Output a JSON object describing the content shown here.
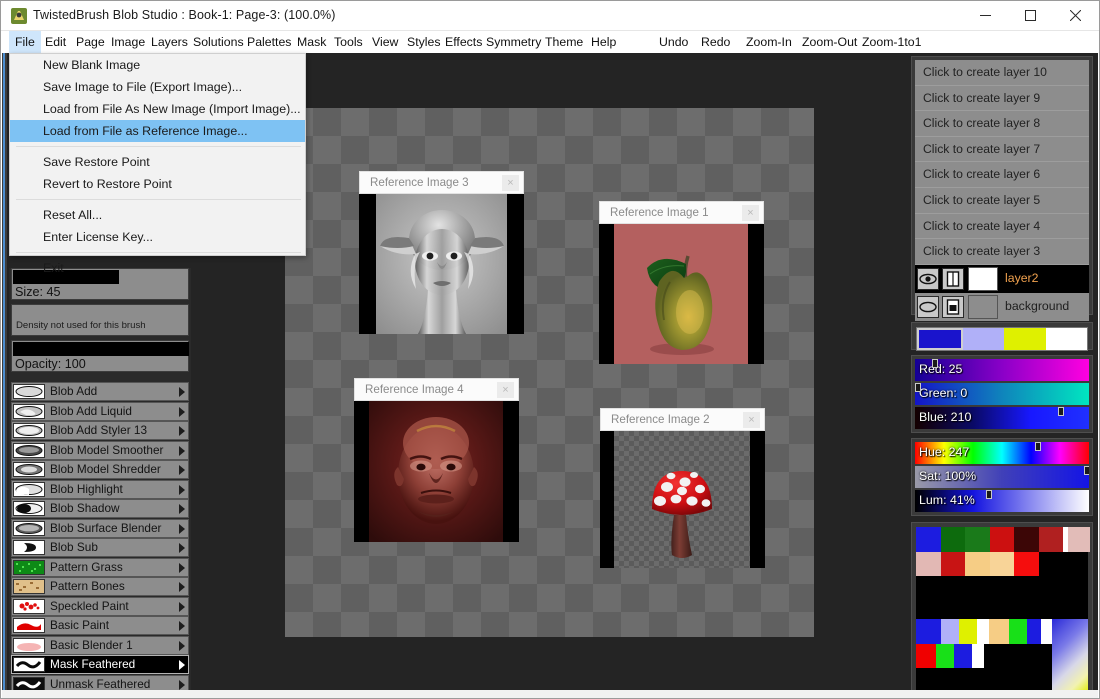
{
  "window": {
    "title": "TwistedBrush Blob Studio : Book-1: Page-3:  (100.0%)",
    "app_icon": "app-icon",
    "minimize": "–",
    "maximize": "□",
    "close": "✕"
  },
  "menubar": {
    "items": [
      {
        "label": "File",
        "active": true
      },
      {
        "label": "Edit",
        "active": false
      },
      {
        "label": "Page",
        "active": false
      },
      {
        "label": "Image",
        "active": false
      },
      {
        "label": "Layers",
        "active": false
      },
      {
        "label": "Solutions",
        "active": false
      },
      {
        "label": "Palettes",
        "active": false
      },
      {
        "label": "Mask",
        "active": false
      },
      {
        "label": "Tools",
        "active": false
      },
      {
        "label": "View",
        "active": false
      },
      {
        "label": "Styles",
        "active": false
      },
      {
        "label": "Effects",
        "active": false
      },
      {
        "label": "Symmetry",
        "active": false
      },
      {
        "label": "Theme",
        "active": false
      },
      {
        "label": "Help",
        "active": false
      },
      {
        "label": "Undo",
        "active": false
      },
      {
        "label": "Redo",
        "active": false
      },
      {
        "label": "Zoom-In",
        "active": false
      },
      {
        "label": "Zoom-Out",
        "active": false
      },
      {
        "label": "Zoom-1to1",
        "active": false
      }
    ]
  },
  "file_menu": {
    "open": true,
    "items": [
      {
        "label": "New Blank Image",
        "selected": false
      },
      {
        "label": "Save Image to File (Export Image)...",
        "selected": false
      },
      {
        "label": "Load from File As New Image (Import Image)...",
        "selected": false
      },
      {
        "label": "Load from File as Reference Image...",
        "selected": true
      },
      {
        "separator": true
      },
      {
        "label": "Save Restore Point",
        "selected": false
      },
      {
        "label": "Revert to Restore Point",
        "selected": false
      },
      {
        "separator": true
      },
      {
        "label": "Reset All...",
        "selected": false
      },
      {
        "label": "Enter License Key...",
        "selected": false
      },
      {
        "separator": true
      },
      {
        "label": "Exit",
        "selected": false
      }
    ]
  },
  "brush_panel": {
    "size": {
      "label": "Size: 45",
      "value": 45,
      "fill_percent": 60
    },
    "density": {
      "label": "Density not used for this brush"
    },
    "opacity": {
      "label": "Opacity: 100",
      "value": 100,
      "fill_percent": 100
    },
    "brushes": [
      {
        "label": "Blob Add",
        "selected": false
      },
      {
        "label": "Blob Add Liquid",
        "selected": false
      },
      {
        "label": "Blob Add Styler 13",
        "selected": false
      },
      {
        "label": "Blob Model Smoother",
        "selected": false
      },
      {
        "label": "Blob Model Shredder",
        "selected": false
      },
      {
        "label": "Blob Highlight",
        "selected": false
      },
      {
        "label": "Blob Shadow",
        "selected": false
      },
      {
        "label": "Blob Surface Blender",
        "selected": false
      },
      {
        "label": "Blob Sub",
        "selected": false
      },
      {
        "label": "Pattern Grass",
        "selected": false
      },
      {
        "label": "Pattern Bones",
        "selected": false
      },
      {
        "label": "Speckled Paint",
        "selected": false
      },
      {
        "label": "Basic Paint",
        "selected": false
      },
      {
        "label": "Basic Blender 1",
        "selected": false
      },
      {
        "label": "Mask Feathered",
        "selected": true
      },
      {
        "label": "Unmask Feathered",
        "selected": false
      }
    ]
  },
  "canvas": {
    "reference_images": [
      {
        "title": "Reference Image 3",
        "close": "×",
        "kind": "grayscale-alien-face"
      },
      {
        "title": "Reference Image 1",
        "close": "×",
        "kind": "pear-on-rose"
      },
      {
        "title": "Reference Image 4",
        "close": "×",
        "kind": "red-portrait"
      },
      {
        "title": "Reference Image 2",
        "close": "×",
        "kind": "red-mushroom"
      }
    ]
  },
  "layers_panel": {
    "create_slots": [
      "Click to create layer 10",
      "Click to create layer 9",
      "Click to create layer 8",
      "Click to create layer 7",
      "Click to create layer 6",
      "Click to create layer 5",
      "Click to create layer 4",
      "Click to create layer 3"
    ],
    "layers": [
      {
        "name": "layer2",
        "selected": true,
        "visibility_icon": "eye-open-icon",
        "lock_icon": "page-icon",
        "thumb_color": "#ffffff"
      },
      {
        "name": "background",
        "selected": false,
        "visibility_icon": "eye-closed-icon",
        "lock_icon": "page-filled-icon",
        "thumb_color": "#8d8d8d"
      }
    ]
  },
  "color_panel": {
    "swatches": [
      "#1a14cc",
      "#b0b0f8",
      "#dff000",
      "#ffffff"
    ],
    "rgb_sliders": [
      {
        "label": "Red: 25",
        "value": 25,
        "knob_percent": 10
      },
      {
        "label": "Green: 0",
        "value": 0,
        "knob_percent": 0
      },
      {
        "label": "Blue: 210",
        "value": 210,
        "knob_percent": 82
      }
    ],
    "hsl_sliders": [
      {
        "label": "Hue: 247",
        "value": 247,
        "knob_percent": 69
      },
      {
        "label": "Sat: 100%",
        "value": 100,
        "knob_percent": 98
      },
      {
        "label": "Lum: 41%",
        "value": 41,
        "knob_percent": 41
      }
    ],
    "palette_row1": [
      "#1c1ce0",
      "#0d6b0d",
      "#1a7a1a",
      "#cc1010",
      "#3c0606",
      "#b02020",
      "#ffffff",
      "#e2bcb8"
    ],
    "palette_row2": [
      "#e2b8b4",
      "#c81414",
      "#f6cd85",
      "#f8d498",
      "#f50d0d",
      "#000000",
      "#000000",
      "#000000"
    ],
    "palette_row3": [
      "#1c1ce0",
      "#b0b0f8",
      "#dff000",
      "#ffffff",
      "#f6cd85",
      "#18e018",
      "#1c1ce0",
      "#ffffff"
    ],
    "palette_row4": [
      "#f00000",
      "#18e018",
      "#1c1ce0",
      "#ffffff",
      "#000000",
      "#000000",
      "#000000",
      "#000000"
    ]
  }
}
